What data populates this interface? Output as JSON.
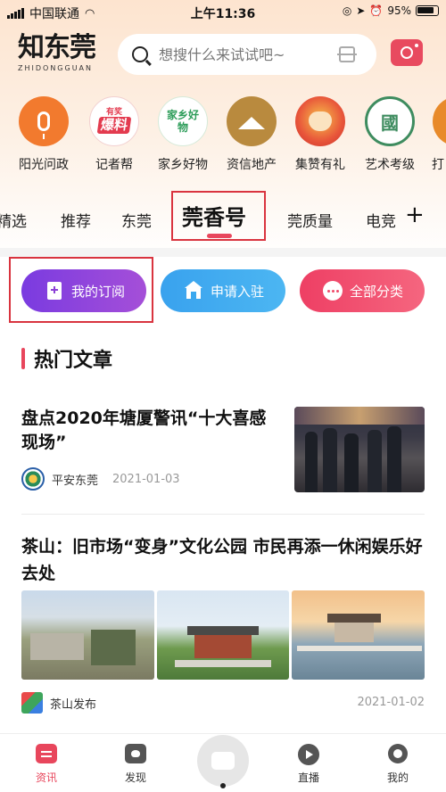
{
  "status_bar": {
    "carrier": "中国联通",
    "time": "上午11:36",
    "battery": "95%"
  },
  "header": {
    "logo_cn": "知东莞",
    "logo_en": "ZHIDONGGUAN",
    "search_placeholder": "想搜什么来试试吧~"
  },
  "categories": [
    {
      "label": "阳光问政",
      "icon": "microphone-icon",
      "color": "#f27a2e"
    },
    {
      "label": "记者帮",
      "icon": "baoliao-badge-icon",
      "badge": "爆料",
      "small": "有奖",
      "color": "#e33b4f"
    },
    {
      "label": "家乡好物",
      "icon": "hometown-goods-icon",
      "badge": "家乡好物",
      "color": "#2e9d5a"
    },
    {
      "label": "资信地产",
      "icon": "house-roof-icon",
      "color": "#b98a3e"
    },
    {
      "label": "集赞有礼",
      "icon": "ox-mascot-icon",
      "color": "#d63a2d"
    },
    {
      "label": "艺术考级",
      "icon": "art-exam-seal-icon",
      "badge": "國",
      "color": "#3e8c5f"
    },
    {
      "label": "打",
      "icon": "partial-icon",
      "color": "#e88a2a"
    }
  ],
  "tabs": [
    {
      "label": "精选"
    },
    {
      "label": "推荐"
    },
    {
      "label": "东莞"
    },
    {
      "label": "莞香号",
      "active": true
    },
    {
      "label": "莞质量"
    },
    {
      "label": "电竞"
    }
  ],
  "pills": [
    {
      "label": "我的订阅",
      "icon": "bookmark-plus-icon"
    },
    {
      "label": "申请入驻",
      "icon": "building-icon"
    },
    {
      "label": "全部分类",
      "icon": "more-dots-icon"
    }
  ],
  "section_title": "热门文章",
  "articles": [
    {
      "title": "盘点2020年塘厦警讯“十大喜感现场”",
      "source": "平安东莞",
      "date": "2021-01-03"
    },
    {
      "title": "茶山：旧市场“变身”文化公园 市民再添一休闲娱乐好去处",
      "source": "茶山发布",
      "date": "2021-01-02"
    }
  ],
  "bottom_nav": [
    {
      "label": "资讯",
      "icon": "news-icon",
      "active": true
    },
    {
      "label": "发现",
      "icon": "discover-icon"
    },
    {
      "label": "",
      "icon": "video-camera-icon"
    },
    {
      "label": "直播",
      "icon": "live-play-icon"
    },
    {
      "label": "我的",
      "icon": "profile-icon"
    }
  ],
  "colors": {
    "accent": "#e8465c",
    "purple": "#8b3fd6",
    "blue": "#3aa8ef",
    "pink": "#f04a6a"
  }
}
